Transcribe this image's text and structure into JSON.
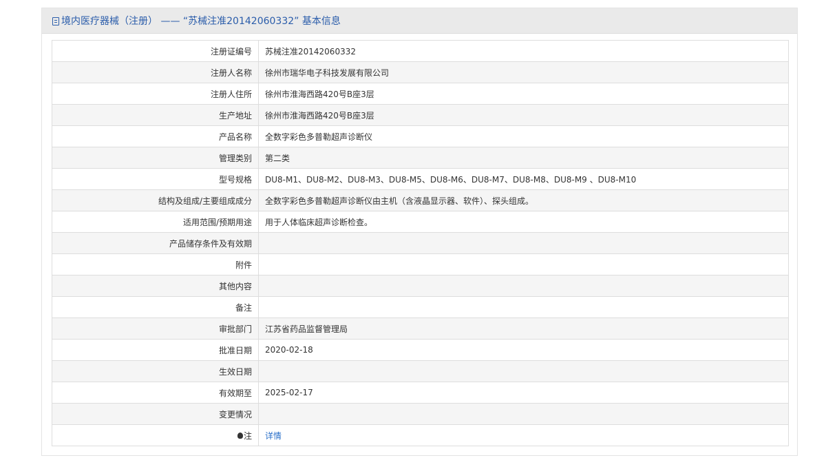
{
  "header": {
    "title": "境内医疗器械（注册） —— “苏械注准20142060332” 基本信息"
  },
  "rows": [
    {
      "label": "注册证编号",
      "value": "苏械注准20142060332"
    },
    {
      "label": "注册人名称",
      "value": "徐州市瑞华电子科技发展有限公司"
    },
    {
      "label": "注册人住所",
      "value": "徐州市淮海西路420号B座3层"
    },
    {
      "label": "生产地址",
      "value": "徐州市淮海西路420号B座3层"
    },
    {
      "label": "产品名称",
      "value": "全数字彩色多普勒超声诊断仪"
    },
    {
      "label": "管理类别",
      "value": "第二类"
    },
    {
      "label": "型号规格",
      "value": "DU8-M1、DU8-M2、DU8-M3、DU8-M5、DU8-M6、DU8-M7、DU8-M8、DU8-M9 、DU8-M10"
    },
    {
      "label": "结构及组成/主要组成成分",
      "value": "全数字彩色多普勒超声诊断仪由主机（含液晶显示器、软件）、探头组成。"
    },
    {
      "label": "适用范围/预期用途",
      "value": "用于人体临床超声诊断检查。"
    },
    {
      "label": "产品储存条件及有效期",
      "value": ""
    },
    {
      "label": "附件",
      "value": ""
    },
    {
      "label": "其他内容",
      "value": ""
    },
    {
      "label": "备注",
      "value": ""
    },
    {
      "label": "审批部门",
      "value": "江苏省药品监督管理局"
    },
    {
      "label": "批准日期",
      "value": "2020-02-18"
    },
    {
      "label": "生效日期",
      "value": ""
    },
    {
      "label": "有效期至",
      "value": "2025-02-17"
    },
    {
      "label": "变更情况",
      "value": ""
    }
  ],
  "note_row": {
    "label": "注",
    "icon": "lightbulb-icon",
    "link": "详情"
  },
  "colors": {
    "accent": "#2a5caa",
    "link": "#2a6fc9",
    "header_bg": "#eaeaea",
    "row_alt": "#f5f5f5"
  }
}
